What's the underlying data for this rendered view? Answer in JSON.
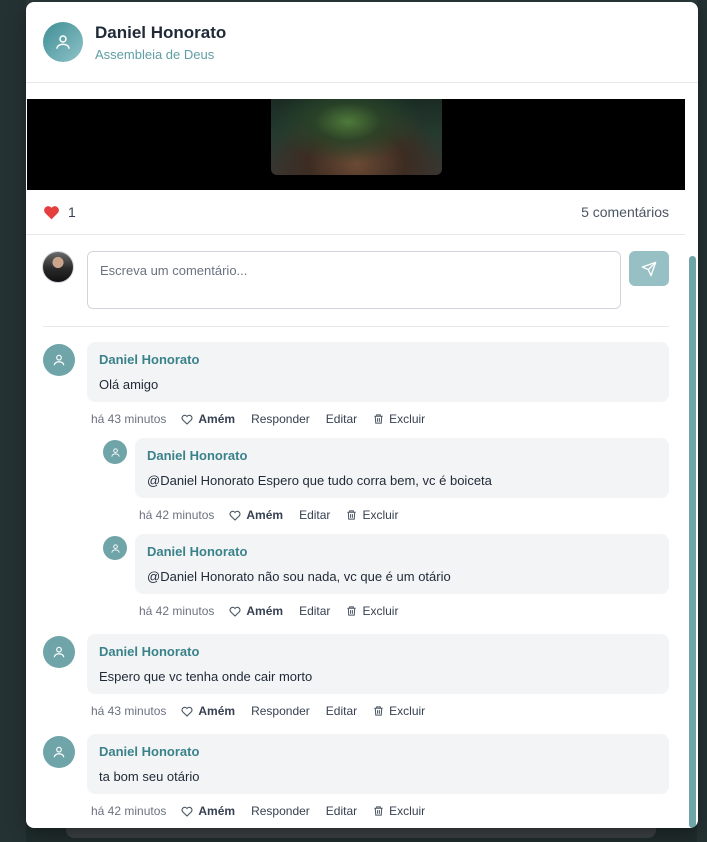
{
  "post": {
    "author_name": "Daniel Honorato",
    "church": "Assembleia de Deus",
    "likes": "1",
    "comments_count": "5 comentários",
    "heart_color": "#e53e3e"
  },
  "composer": {
    "placeholder": "Escreva um comentário..."
  },
  "labels": {
    "amen": "Amém",
    "reply": "Responder",
    "edit": "Editar",
    "delete": "Excluir"
  },
  "comments": [
    {
      "author": "Daniel Honorato",
      "text": "Olá amigo",
      "time": "há 43 minutos"
    },
    {
      "author": "Daniel Honorato",
      "text": "@Daniel Honorato Espero que tudo corra bem, vc é boiceta",
      "time": "há 42 minutos"
    },
    {
      "author": "Daniel Honorato",
      "text": "@Daniel Honorato não sou nada, vc que é um otário",
      "time": "há 42 minutos"
    },
    {
      "author": "Daniel Honorato",
      "text": "Espero que vc tenha onde cair morto",
      "time": "há 43 minutos"
    },
    {
      "author": "Daniel Honorato",
      "text": "ta bom seu otário",
      "time": "há 42 minutos"
    }
  ],
  "colors": {
    "accent": "#3a8289",
    "avatar": "#6fa4a9",
    "send_button": "#97c0c4"
  },
  "icons": {
    "user": "user-icon",
    "heart": "heart-icon",
    "send": "send-icon",
    "trash": "trash-icon"
  }
}
